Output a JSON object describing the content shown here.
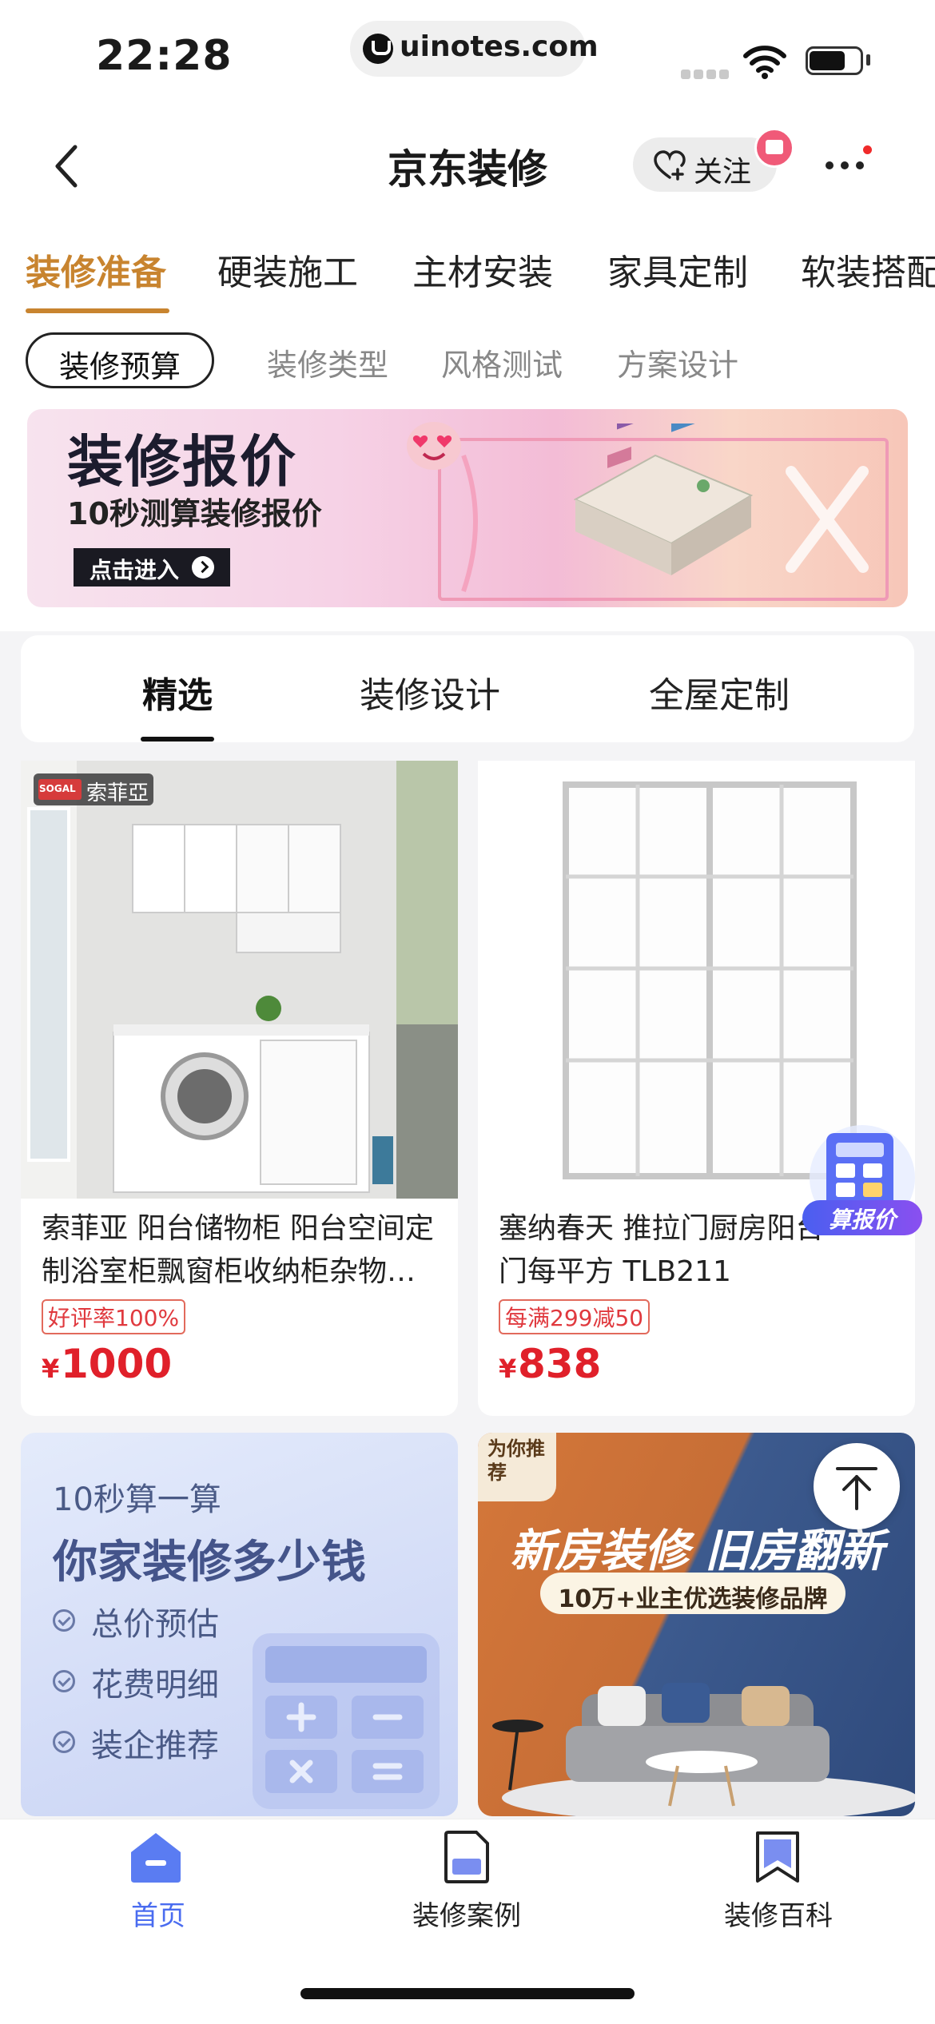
{
  "status_bar": {
    "time": "22:28",
    "url": "uinotes.com"
  },
  "nav": {
    "title": "京东装修",
    "follow_label": "关注",
    "back_icon": "chevron-left-icon",
    "more_icon": "more-dots-icon"
  },
  "category_tabs": [
    {
      "label": "装修准备",
      "active": true
    },
    {
      "label": "硬装施工"
    },
    {
      "label": "主材安装"
    },
    {
      "label": "家具定制"
    },
    {
      "label": "软装搭配"
    }
  ],
  "sub_tabs": [
    {
      "label": "装修预算",
      "active": true
    },
    {
      "label": "装修类型"
    },
    {
      "label": "风格测试"
    },
    {
      "label": "方案设计"
    }
  ],
  "banner": {
    "title": "装修报价",
    "subtitle": "10秒测算装修报价",
    "button_label": "点击进入"
  },
  "content_tabs": [
    {
      "label": "精选",
      "active": true
    },
    {
      "label": "装修设计"
    },
    {
      "label": "全屋定制"
    }
  ],
  "products": [
    {
      "brand_logo": "SOGAL",
      "brand": "索菲亞",
      "title_line1": "索菲亚 阳台储物柜 阳台空间定",
      "title_line2": "制浴室柜飘窗柜收纳柜杂物…",
      "tag": "好评率100%",
      "currency": "¥",
      "price": "1000"
    },
    {
      "title_line1": "塞纳春天 推拉门厨房阳台",
      "title_line2": "门每平方 TLB211",
      "tag": "每满299减50",
      "currency": "¥",
      "price": "838"
    }
  ],
  "calc_float_label": "算报价",
  "promo_calc": {
    "line1": "10秒算一算",
    "line2": "你家装修多少钱",
    "items": [
      "总价预估",
      "花费明细",
      "装企推荐"
    ]
  },
  "promo_brand": {
    "badge": "为你推荐",
    "title": "新房装修 旧房翻新",
    "subtitle": "10万+业主优选装修品牌"
  },
  "bottom_nav": [
    {
      "label": "首页",
      "icon": "home-icon",
      "active": true
    },
    {
      "label": "装修案例",
      "icon": "document-icon"
    },
    {
      "label": "装修百科",
      "icon": "bookmark-icon"
    }
  ],
  "colors": {
    "accent": "#c8842f",
    "price": "#e0202a",
    "nav_active": "#4a6cf0"
  }
}
